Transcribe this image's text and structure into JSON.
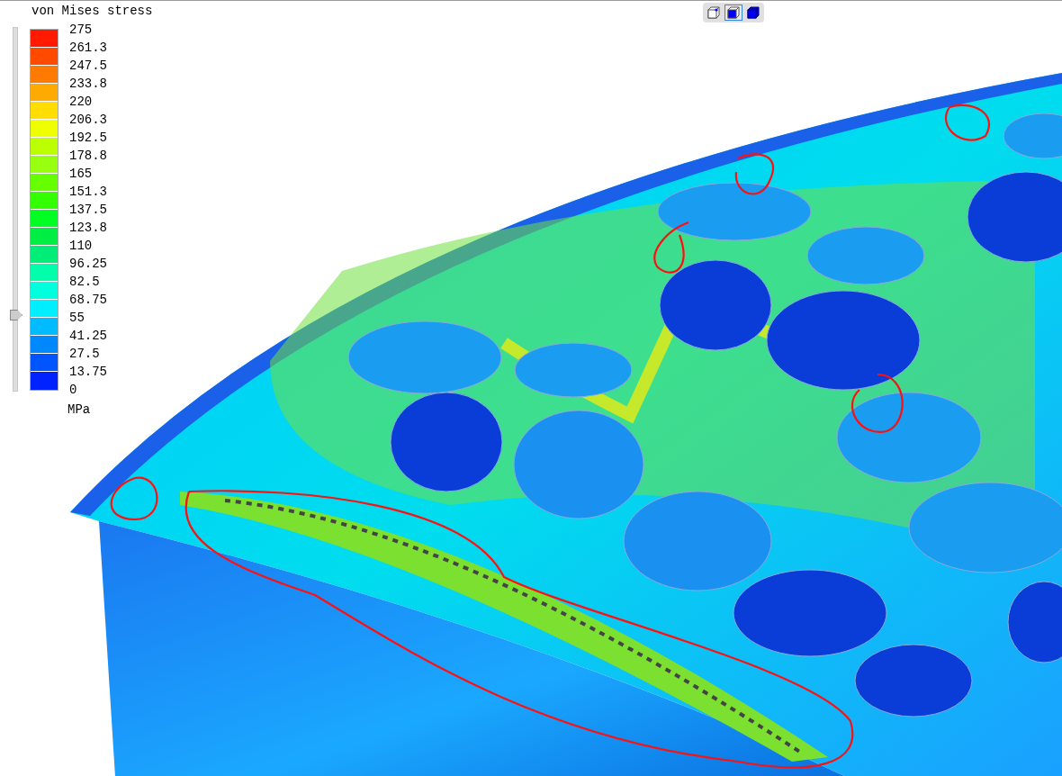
{
  "legend": {
    "title": "von Mises stress",
    "unit": "MPa",
    "labels": [
      "275",
      "261.3",
      "247.5",
      "233.8",
      "220",
      "206.3",
      "192.5",
      "178.8",
      "165",
      "151.3",
      "137.5",
      "123.8",
      "110",
      "96.25",
      "82.5",
      "68.75",
      "55",
      "41.25",
      "27.5",
      "13.75",
      "0"
    ],
    "bands": [
      {
        "color": "#ff1a00"
      },
      {
        "color": "#ff4a00"
      },
      {
        "color": "#ff7a00"
      },
      {
        "color": "#ffaa00"
      },
      {
        "color": "#ffdd00"
      },
      {
        "color": "#eeff00"
      },
      {
        "color": "#bbff00"
      },
      {
        "color": "#99ff11"
      },
      {
        "color": "#66ff00"
      },
      {
        "color": "#33ff00"
      },
      {
        "color": "#00ff22"
      },
      {
        "color": "#00ee44"
      },
      {
        "color": "#00ee77"
      },
      {
        "color": "#00ffaa"
      },
      {
        "color": "#00ffdd"
      },
      {
        "color": "#00eeff"
      },
      {
        "color": "#00bbff"
      },
      {
        "color": "#0088ff"
      },
      {
        "color": "#0055ff"
      },
      {
        "color": "#0022ff"
      }
    ],
    "threshold": {
      "level": 0.21
    }
  },
  "view_buttons": [
    {
      "kind": "wireframe",
      "selected": false
    },
    {
      "kind": "shaded",
      "selected": true
    },
    {
      "kind": "solid",
      "selected": false
    }
  ]
}
